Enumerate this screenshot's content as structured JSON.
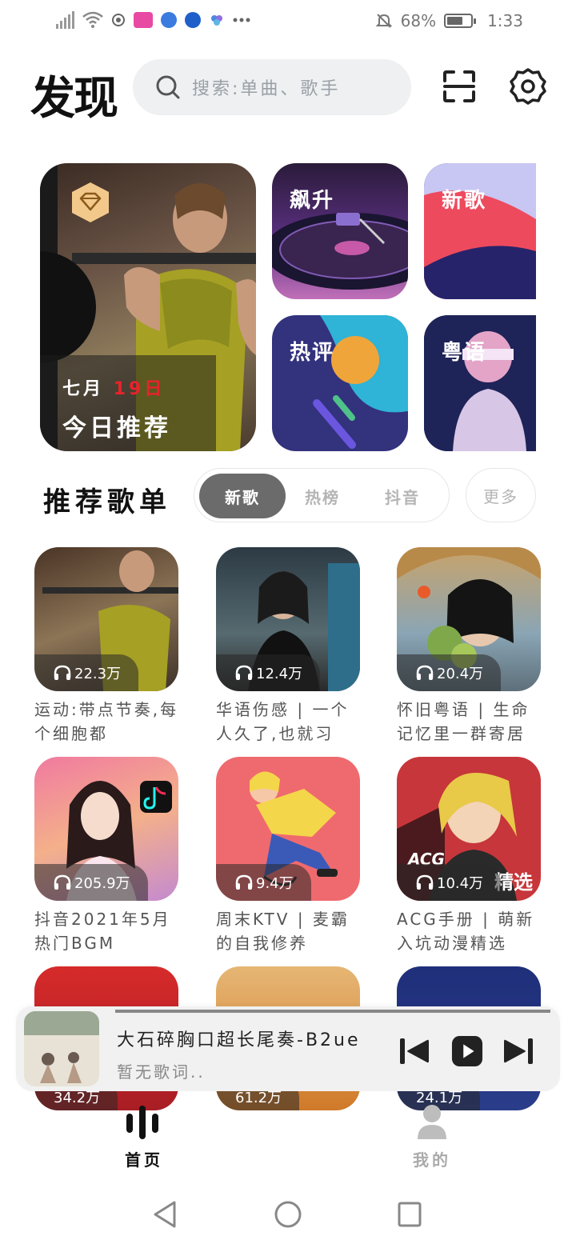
{
  "status_bar": {
    "battery": "68%",
    "battery_level": 0.68,
    "time": "1:33",
    "icons": [
      "signal-icon",
      "wifi-icon",
      "record-icon",
      "app-notification-icon",
      "browser-icon",
      "message-icon",
      "cloud-icon",
      "more-icon",
      "mute-icon",
      "battery-icon"
    ]
  },
  "header": {
    "title": "发现",
    "search_placeholder": "搜索:单曲、歌手",
    "icons": {
      "search": "search-icon",
      "scan": "scan-icon",
      "settings": "settings-gear-icon"
    }
  },
  "featured": {
    "daily": {
      "month": "七月",
      "day": "19日",
      "label": "今日推荐"
    },
    "cards": [
      {
        "label": "飙升"
      },
      {
        "label": "新歌"
      },
      {
        "label": "热评"
      },
      {
        "label": "粤语"
      }
    ]
  },
  "playlists": {
    "heading": "推荐歌单",
    "tabs": [
      {
        "label": "新歌",
        "active": true
      },
      {
        "label": "热榜",
        "active": false
      },
      {
        "label": "抖音",
        "active": false
      }
    ],
    "more_label": "更多",
    "items": [
      {
        "count": "22.3万",
        "name": "运动:带点节奏,每个细胞都"
      },
      {
        "count": "12.4万",
        "name": "华语伤感 | 一个人久了,也就习"
      },
      {
        "count": "20.4万",
        "name": "怀旧粤语 | 生命记忆里一群寄居"
      },
      {
        "count": "205.9万",
        "name": "抖音2021年5月热门BGM"
      },
      {
        "count": "9.4万",
        "name": "周末KTV | 麦霸的自我修养"
      },
      {
        "count": "10.4万",
        "name": "ACG手册 | 萌新入坑动漫精选",
        "overlay_text": "ACG",
        "badge": "精选"
      },
      {
        "count": "34.2万",
        "name": ""
      },
      {
        "count": "61.2万",
        "name": ""
      },
      {
        "count": "24.1万",
        "name": ""
      }
    ]
  },
  "player": {
    "song": "大石碎胸口超长尾奏-B2ue",
    "lyric": "暂无歌词..",
    "progress": 1.0
  },
  "bottom_nav": [
    {
      "label": "首页",
      "active": true
    },
    {
      "label": "我的",
      "active": false
    }
  ],
  "colors": {
    "accent_red": "#e8232b",
    "tab_active": "#6b6b6b",
    "search_bg": "#eef0f2",
    "player_bg": "#f1f1f1"
  }
}
